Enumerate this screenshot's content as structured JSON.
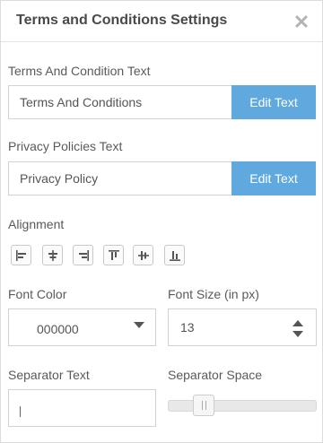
{
  "dialog": {
    "title": "Terms and Conditions Settings",
    "close_icon": "close-x-icon"
  },
  "terms": {
    "label": "Terms And Condition Text",
    "value": "Terms And Conditions",
    "button": "Edit Text"
  },
  "privacy": {
    "label": "Privacy Policies Text",
    "value": "Privacy Policy",
    "button": "Edit Text"
  },
  "alignment": {
    "label": "Alignment",
    "options": [
      "align-left-icon",
      "align-center-icon",
      "align-right-icon",
      "align-top-icon",
      "align-middle-icon",
      "align-bottom-icon"
    ]
  },
  "font_color": {
    "label": "Font Color",
    "value": "000000"
  },
  "font_size": {
    "label": "Font Size (in px)",
    "value": "13"
  },
  "separator_text": {
    "label": "Separator Text",
    "value": ""
  },
  "separator_space": {
    "label": "Separator Space",
    "level": 0.17
  },
  "colors": {
    "accent": "#5fa9df",
    "border": "#d2d2d2",
    "text": "#555555"
  }
}
